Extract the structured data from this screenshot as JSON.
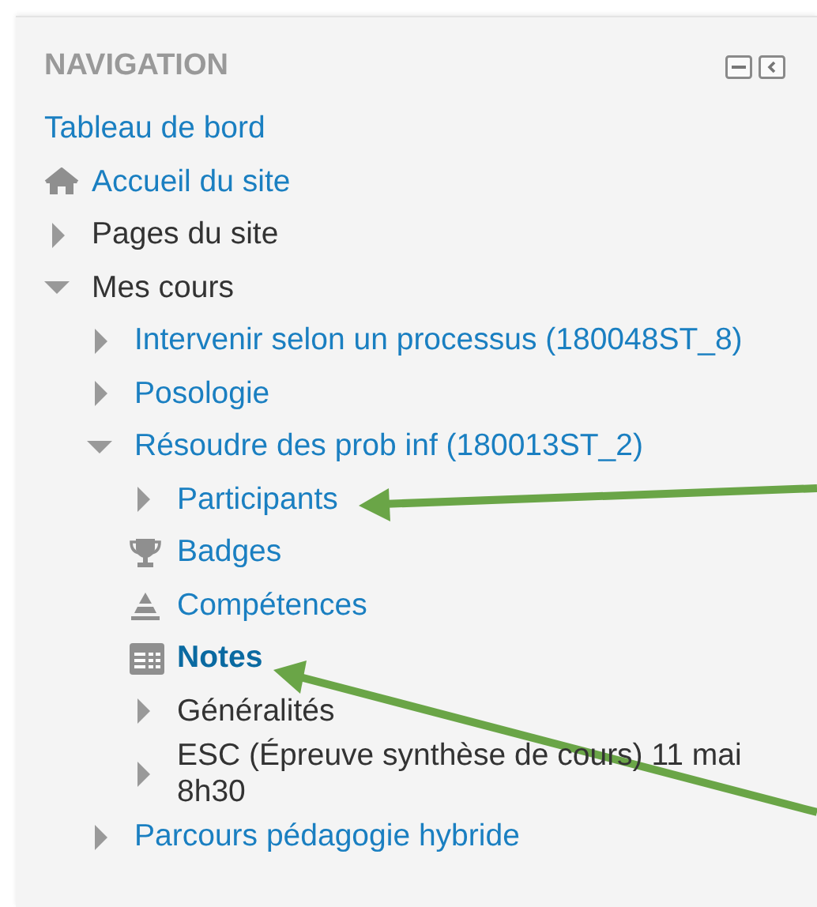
{
  "block": {
    "title": "NAVIGATION",
    "items": [
      {
        "label": "Tableau de bord",
        "kind": "plain",
        "link": true,
        "active": false
      },
      {
        "label": "Accueil du site",
        "kind": "home",
        "link": true,
        "active": false
      },
      {
        "label": "Pages du site",
        "kind": "branch",
        "link": false,
        "active": false,
        "expanded": false
      },
      {
        "label": "Mes cours",
        "kind": "branch",
        "link": false,
        "active": false,
        "expanded": true,
        "children": [
          {
            "label": "Intervenir selon un processus (180048ST_8)",
            "kind": "branch",
            "link": true,
            "active": false,
            "expanded": false
          },
          {
            "label": "Posologie",
            "kind": "branch",
            "link": true,
            "active": false,
            "expanded": false
          },
          {
            "label": "Résoudre des prob inf (180013ST_2)",
            "kind": "branch",
            "link": true,
            "active": false,
            "expanded": true,
            "children": [
              {
                "label": "Participants",
                "kind": "branch",
                "link": true,
                "active": false,
                "expanded": false
              },
              {
                "label": "Badges",
                "kind": "badges",
                "link": true,
                "active": false
              },
              {
                "label": "Compétences",
                "kind": "competencies",
                "link": true,
                "active": false
              },
              {
                "label": "Notes",
                "kind": "grades",
                "link": true,
                "active": true
              },
              {
                "label": "Généralités",
                "kind": "branch",
                "link": false,
                "active": false,
                "expanded": false
              },
              {
                "label": "ESC (Épreuve synthèse de cours) 11 mai 8h30",
                "kind": "branch",
                "link": false,
                "active": false,
                "expanded": false
              }
            ]
          },
          {
            "label": "Parcours pédagogie hybride",
            "kind": "branch",
            "link": true,
            "active": false,
            "expanded": false
          }
        ]
      }
    ]
  }
}
